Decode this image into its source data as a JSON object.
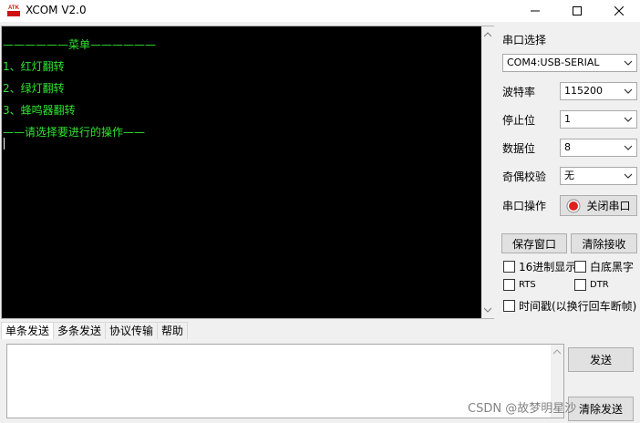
{
  "window": {
    "title": "XCOM V2.0",
    "logo_text": "ATK"
  },
  "terminal": {
    "lines": [
      "——————菜单——————",
      "1、红灯翻转",
      "2、绿灯翻转",
      "3、蜂鸣器翻转",
      "——请选择要进行的操作——"
    ],
    "text_color": "#2fe32f",
    "background": "#000000"
  },
  "serial_panel": {
    "section_title": "串口选择",
    "port_value": "COM4:USB-SERIAL",
    "baud_label": "波特率",
    "baud_value": "115200",
    "stopbits_label": "停止位",
    "stopbits_value": "1",
    "databits_label": "数据位",
    "databits_value": "8",
    "parity_label": "奇偶校验",
    "parity_value": "无",
    "operation_label": "串口操作",
    "close_port_label": "关闭串口",
    "save_window_label": "保存窗口",
    "clear_receive_label": "清除接收",
    "hex_display_label": "16进制显示",
    "white_bg_label": "白底黑字",
    "rts_label": "RTS",
    "dtr_label": "DTR",
    "timestamp_label": "时间戳(以换行回车断帧)"
  },
  "bottom": {
    "tabs": [
      "单条发送",
      "多条发送",
      "协议传输",
      "帮助"
    ],
    "send_button": "发送",
    "clear_send_button": "清除发送"
  },
  "watermark": "CSDN @故梦明星沙",
  "colors": {
    "status_red": "#e02020",
    "accent_green": "#2fe32f"
  }
}
